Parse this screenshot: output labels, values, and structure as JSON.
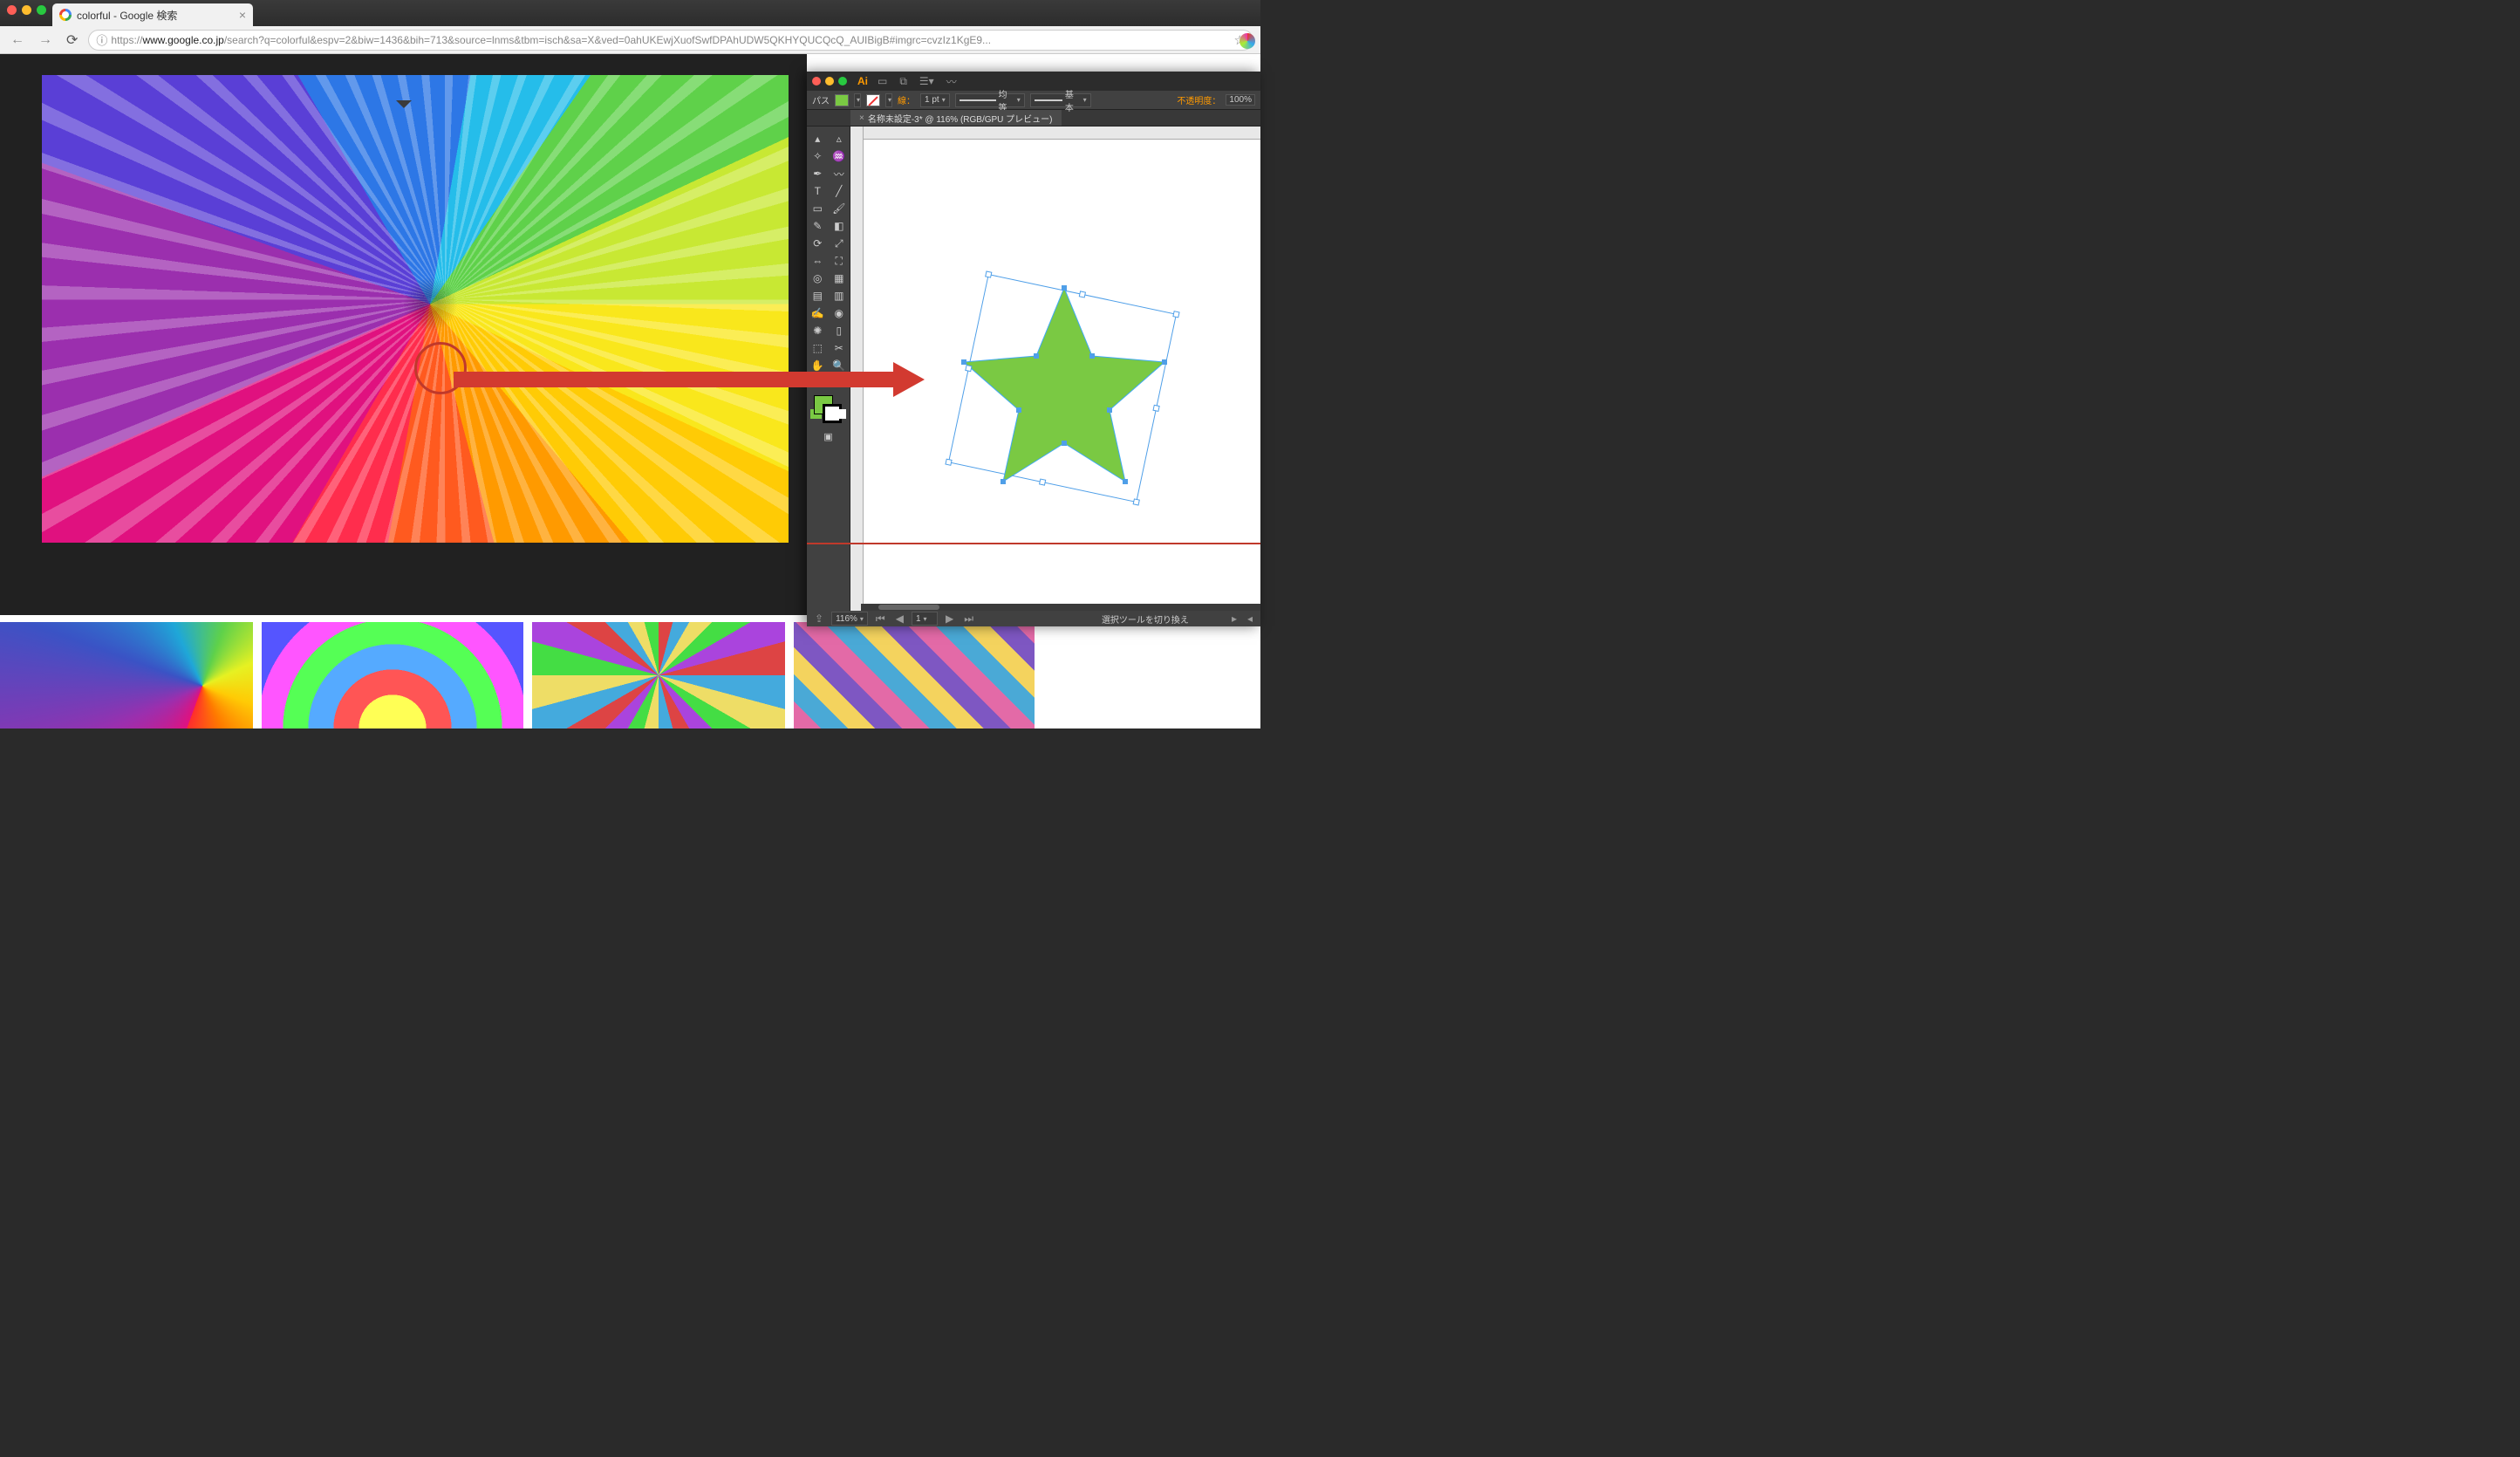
{
  "browser": {
    "tab_title": "colorful - Google 検索",
    "url_protocol": "https://",
    "url_host": "www.google.co.jp",
    "url_path": "/search?q=colorful&espv=2&biw=1436&bih=713&source=lnms&tbm=isch&sa=X&ved=0ahUKEwjXuofSwfDPAhUDW5QKHYQUCQcQ_AUIBigB#imgrc=cvzIz1KgE9..."
  },
  "illustrator": {
    "app_short": "Ai",
    "path_label": "パス",
    "stroke_label": "線：",
    "stroke_width": "1 pt",
    "stroke_profile": "均等",
    "stroke_style": "基本",
    "opacity_label": "不透明度：",
    "opacity_value": "100%",
    "doc_tab": "名称未設定-3* @ 116% (RGB/GPU プレビュー)",
    "zoom": "116%",
    "artboard_nav": "1",
    "status_text": "選択ツールを切り換え",
    "fill_color": "#7ac943",
    "star_color": "#7ac943",
    "tools": [
      "selection",
      "direct-selection",
      "magic-wand",
      "lasso",
      "pen",
      "curvature",
      "type",
      "line",
      "rectangle",
      "paintbrush",
      "pencil",
      "eraser",
      "rotate",
      "scale",
      "width",
      "free-transform",
      "shape-builder",
      "perspective",
      "mesh",
      "gradient",
      "eyedropper",
      "blend",
      "symbol-sprayer",
      "column-graph",
      "artboard",
      "slice",
      "hand",
      "zoom"
    ]
  },
  "annotation": {
    "purpose": "eyedropper-pick-color-into-illustrator"
  }
}
